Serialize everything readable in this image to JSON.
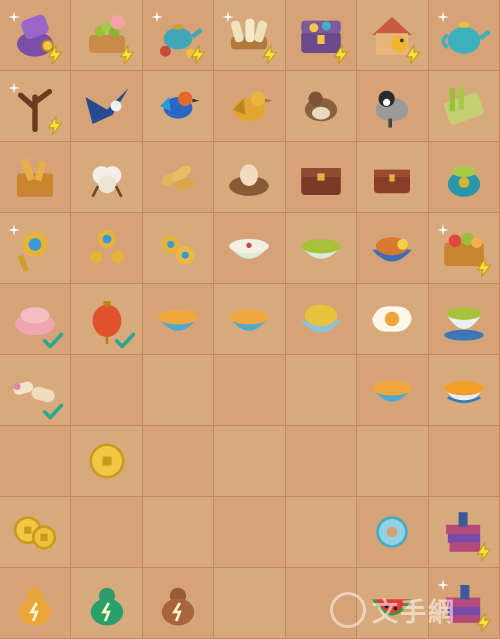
{
  "board": {
    "columns": 7,
    "rows": 9,
    "cells": [
      [
        "bag-of-coins",
        "grapes-basket",
        "teapot-set",
        "scroll-bundle",
        "treasure-chest",
        "bird-cottage",
        "teapot"
      ],
      [
        "tree-branch",
        "blue-swallow",
        "colorful-bird",
        "yellow-bird",
        "brown-sparrow",
        "black-white-bird",
        "bamboo-mat"
      ],
      [
        "wooden-box",
        "cotton-boll",
        "rice-grains",
        "egg-nest",
        "closed-wooden-chest",
        "small-wooden-chest",
        "tea-jar"
      ],
      [
        "gold-brooch",
        "gold-earrings",
        "gold-flower-hairpin",
        "congee-bowl",
        "green-congee-bowl",
        "roast-chicken-bowl",
        "food-basket"
      ],
      [
        "pink-rice-cake",
        "red-lantern",
        "orange-soup-bowl",
        "orange-soup-bowl",
        "corn-rice-bowl",
        "fried-egg",
        "green-tea-cup"
      ],
      [
        "spring-rolls",
        "",
        "",
        "",
        "",
        "orange-soup-bowl",
        "egg-custard-bowl"
      ],
      [
        "",
        "gold-coin",
        "",
        "",
        "",
        "",
        ""
      ],
      [
        "gold-coins-pair",
        "",
        "",
        "",
        "",
        "jade-ring",
        "pink-book-stack"
      ],
      [
        "orange-energy-gourd",
        "green-energy-gourd",
        "brown-energy-gourd",
        "",
        "",
        "watermelon-slice",
        "book-stack-sparkle"
      ]
    ],
    "bolt_badges": [
      [
        0,
        0
      ],
      [
        0,
        1
      ],
      [
        0,
        2
      ],
      [
        0,
        3
      ],
      [
        0,
        4
      ],
      [
        0,
        5
      ],
      [
        1,
        0
      ],
      [
        3,
        6
      ],
      [
        7,
        6
      ],
      [
        8,
        6
      ]
    ],
    "check_badges": [
      [
        4,
        0
      ],
      [
        4,
        1
      ],
      [
        5,
        0
      ]
    ],
    "sparkle_cells": [
      [
        0,
        0
      ],
      [
        0,
        2
      ],
      [
        0,
        3
      ],
      [
        0,
        6
      ],
      [
        1,
        0
      ],
      [
        3,
        0
      ],
      [
        3,
        6
      ],
      [
        8,
        6
      ]
    ]
  },
  "watermark": {
    "text": "文手網"
  },
  "colors": {
    "board_bg": "#cf9a6c",
    "cell": "#d5a377",
    "cell_alt": "#d9a97e",
    "grid_line": "#c08a5c"
  }
}
